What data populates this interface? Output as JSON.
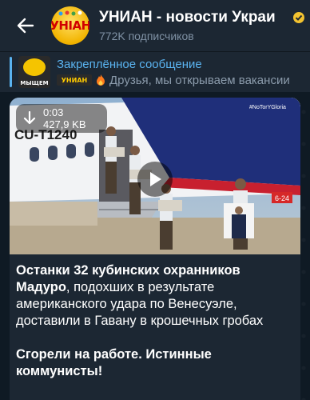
{
  "header": {
    "channel_title": "УНИАН - новости Украи",
    "avatar_text": "УНІАН",
    "subscribers": "772K подписчиков",
    "back_icon": "arrow-left-icon"
  },
  "pinned": {
    "label": "Закреплённое сообщение",
    "thumb_text": "МЫЩЕМ",
    "mini_logo_text": "УНИАН",
    "preview": "Друзья, мы открываем вакансии"
  },
  "video": {
    "duration": "0:03",
    "size": "427,9 KB",
    "plane_text": "CU-T1240",
    "tag_text": "#NoTorYGloria",
    "sign_text": "6-24"
  },
  "post": {
    "bold1": "Останки 32 кубинских охранников Мадуро",
    "rest1": ", подохших в результате американского удара по Венесуэле, доставили в Гавану в крошечных гробах",
    "bold2": "Сгорели на работе. Истинные коммунисты!"
  },
  "colors": {
    "accent": "#5ab3f0",
    "header_bg": "#1c2733",
    "chat_bg": "#0f1a24"
  }
}
